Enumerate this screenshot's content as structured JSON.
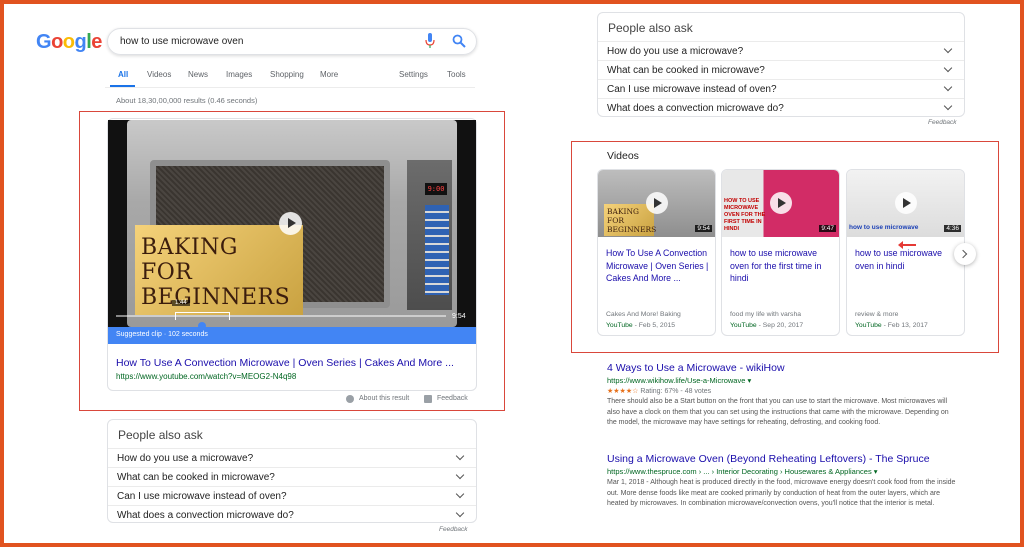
{
  "logo": [
    "G",
    "o",
    "o",
    "g",
    "l",
    "e"
  ],
  "search": {
    "query": "how to use microwave oven"
  },
  "tabs": {
    "all": "All",
    "videos": "Videos",
    "news": "News",
    "images": "Images",
    "shopping": "Shopping",
    "more": "More",
    "settings": "Settings",
    "tools": "Tools"
  },
  "results_count": "About 18,30,00,000 results (0.46 seconds)",
  "featured_video": {
    "overlay_title": [
      "BAKING",
      "FOR",
      "BEGINNERS"
    ],
    "display": "9:00",
    "clip_time": "1:44",
    "duration": "9:54",
    "suggested_clip": "Suggested clip · 102 seconds",
    "title": "How To Use A Convection Microwave | Oven Series | Cakes And More ...",
    "url": "https://www.youtube.com/watch?v=MEOG2-N4q98",
    "about": "About this result",
    "feedback": "Feedback"
  },
  "paa_left": {
    "heading": "People also ask",
    "questions": [
      "How do you use a microwave?",
      "What can be cooked in microwave?",
      "Can I use microwave instead of oven?",
      "What does a convection microwave do?"
    ],
    "feedback": "Feedback"
  },
  "paa_right": {
    "heading": "People also ask",
    "questions": [
      "How do you use a microwave?",
      "What can be cooked in microwave?",
      "Can I use microwave instead of oven?",
      "What does a convection microwave do?"
    ],
    "feedback": "Feedback"
  },
  "videos_carousel": {
    "heading": "Videos",
    "items": [
      {
        "thumb_text": "BAKING FOR BEGINNERS",
        "duration": "9:54",
        "title": "How To Use A Convection Microwave | Oven Series | Cakes And More ...",
        "channel": "Cakes And More! Baking",
        "source": "YouTube",
        "date": "Feb 5, 2015"
      },
      {
        "thumb_text": "HOW TO USE MICROWAVE OVEN FOR THE FIRST TIME IN HINDI",
        "duration": "9:47",
        "title": "how to use microwave oven for the first time in hindi",
        "channel": "food my life with varsha",
        "source": "YouTube",
        "date": "Sep 20, 2017"
      },
      {
        "thumb_text": "how to use microwave",
        "duration": "4:36",
        "title": "how to use microwave oven in hindi",
        "channel": "review & more",
        "source": "YouTube",
        "date": "Feb 13, 2017"
      }
    ]
  },
  "results": [
    {
      "title": "4 Ways to Use a Microwave - wikiHow",
      "url": "https://www.wikihow.life/Use-a-Microwave ▾",
      "stars": "★★★★☆",
      "rating": "Rating: 67% - 48 votes",
      "snippet": "There should also be a Start button on the front that you can use to start the microwave. Most microwaves will also have a clock on them that you can set using the instructions that came with the microwave. Depending on the model, the microwave may have settings for reheating, defrosting, and cooking food."
    },
    {
      "title": "Using a Microwave Oven (Beyond Reheating Leftovers) - The Spruce",
      "url": "https://www.thespruce.com › ... › Interior Decorating › Housewares & Appliances ▾",
      "snippet": "Mar 1, 2018 - Although heat is produced directly in the food, microwave energy doesn't cook food from the inside out. More dense foods like meat are cooked primarily by conduction of heat from the outer layers, which are heated by microwaves. In combination microwave/convection ovens, you'll notice that the interior is metal."
    }
  ],
  "colors": {
    "frame": "#e1531f",
    "highlight_box": "#d9473b",
    "link": "#1a0dab",
    "url": "#006621",
    "accent": "#4285f4"
  }
}
